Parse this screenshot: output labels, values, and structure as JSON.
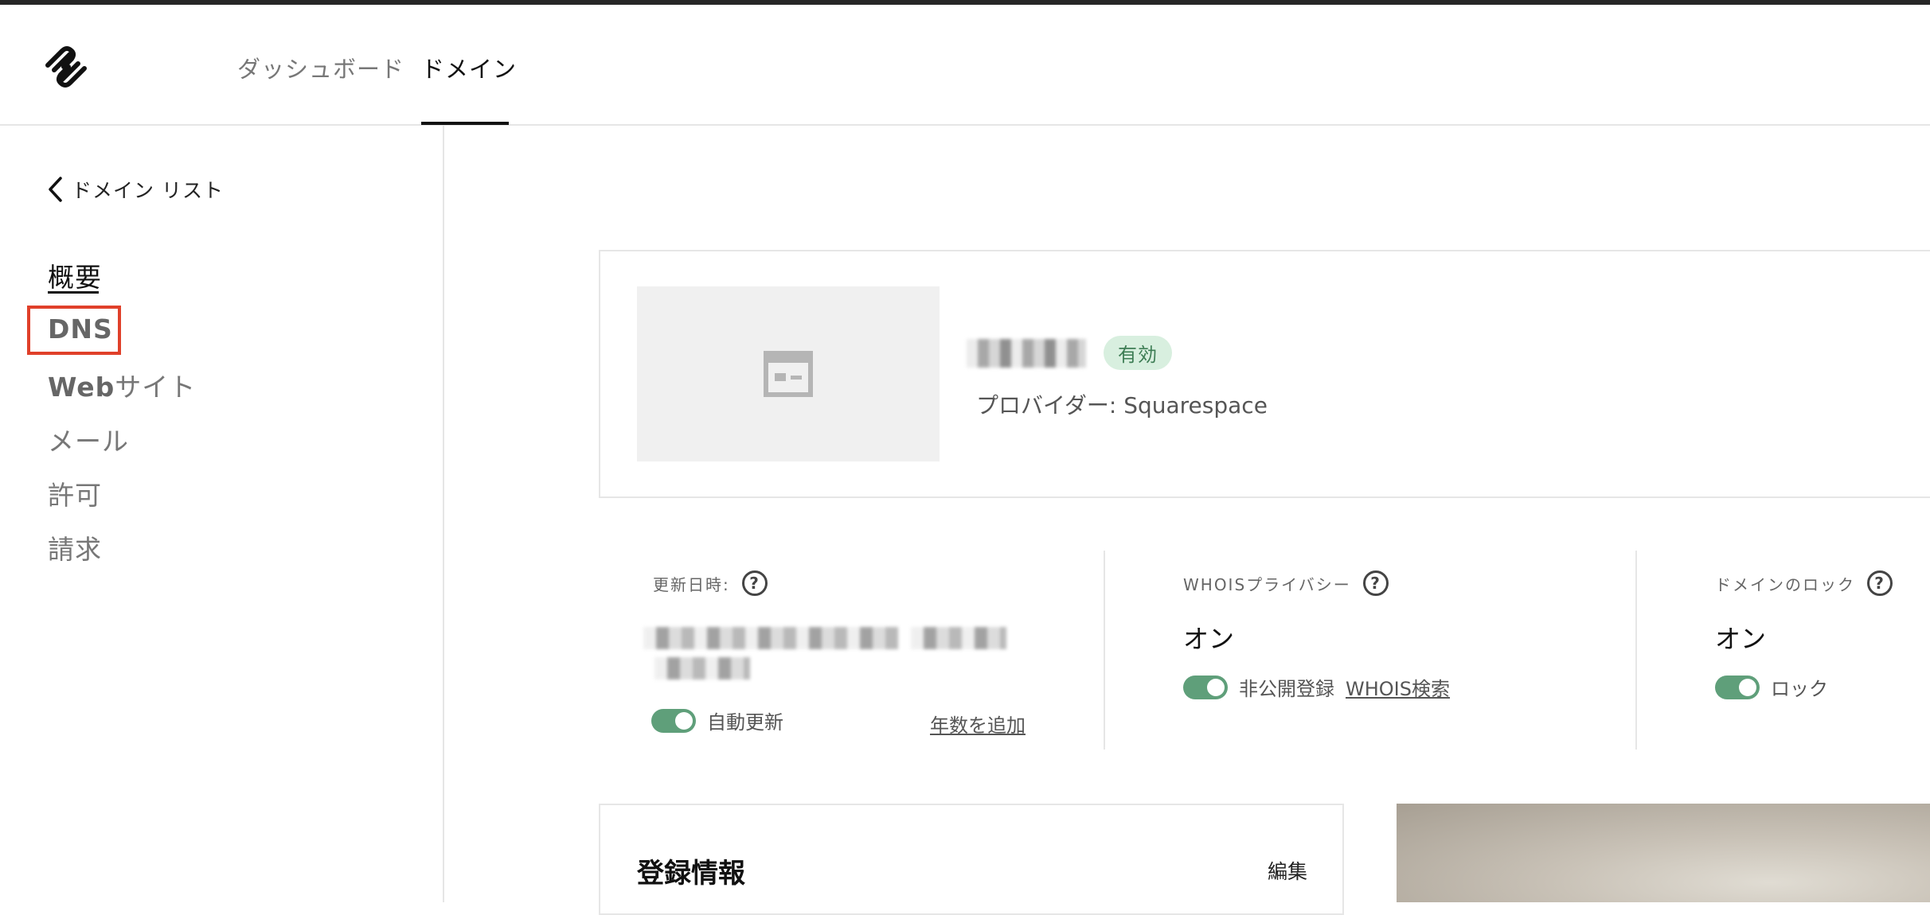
{
  "header": {
    "tabs": [
      {
        "label": "ダッシュボード",
        "active": false
      },
      {
        "label": "ドメイン",
        "active": true
      }
    ]
  },
  "sidebar": {
    "back_label": "ドメイン リスト",
    "items": [
      {
        "label": "概要",
        "active": true
      },
      {
        "label": "DNS",
        "highlighted": true
      },
      {
        "label": "Webサイト"
      },
      {
        "label": "メール"
      },
      {
        "label": "許可"
      },
      {
        "label": "請求"
      }
    ]
  },
  "domain": {
    "status": "有効",
    "provider": "プロバイダー: Squarespace"
  },
  "info": {
    "renewal": {
      "label": "更新日時:",
      "toggle_label": "自動更新",
      "link": "年数を追加",
      "toggle_on": true
    },
    "whois": {
      "label": "WHOISプライバシー",
      "value": "オン",
      "toggle_label": "非公開登録",
      "link": "WHOIS検索",
      "toggle_on": true
    },
    "lock": {
      "label": "ドメインのロック",
      "value": "オン",
      "toggle_label": "ロック",
      "toggle_on": true
    }
  },
  "registration": {
    "title": "登録情報",
    "edit_label": "編集"
  },
  "colors": {
    "accent_green": "#5f9f7a",
    "badge_bg": "#d8efdf",
    "highlight_red": "#e0402a"
  }
}
